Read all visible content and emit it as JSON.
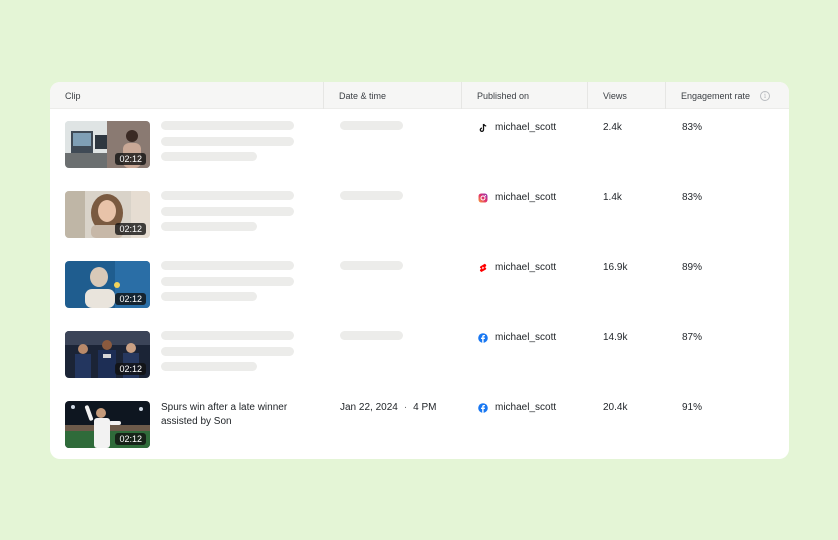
{
  "table": {
    "columns": {
      "clip": "Clip",
      "date_time": "Date & time",
      "published_on": "Published on",
      "views": "Views",
      "engagement": "Engagement rate"
    },
    "rows": [
      {
        "duration": "02:12",
        "title": "",
        "date": "",
        "time": "",
        "platform_icon": "tiktok-icon",
        "account": "michael_scott",
        "views": "2.4k",
        "engagement": "83%"
      },
      {
        "duration": "02:12",
        "title": "",
        "date": "",
        "time": "",
        "platform_icon": "instagram-icon",
        "account": "michael_scott",
        "views": "1.4k",
        "engagement": "83%"
      },
      {
        "duration": "02:12",
        "title": "",
        "date": "",
        "time": "",
        "platform_icon": "youtube-shorts-icon",
        "account": "michael_scott",
        "views": "16.9k",
        "engagement": "89%"
      },
      {
        "duration": "02:12",
        "title": "",
        "date": "",
        "time": "",
        "platform_icon": "facebook-icon",
        "account": "michael_scott",
        "views": "14.9k",
        "engagement": "87%"
      },
      {
        "duration": "02:12",
        "title": "Spurs win after a late winner assisted by Son",
        "date": "Jan 22, 2024",
        "time": "4 PM",
        "platform_icon": "facebook-icon",
        "account": "michael_scott",
        "views": "20.4k",
        "engagement": "91%"
      }
    ]
  },
  "colors": {
    "background": "#e4f5d6",
    "card": "#ffffff",
    "header": "#f6f6f5",
    "skeleton": "#ececea",
    "facebook": "#1877f2",
    "youtube": "#ff0000"
  }
}
